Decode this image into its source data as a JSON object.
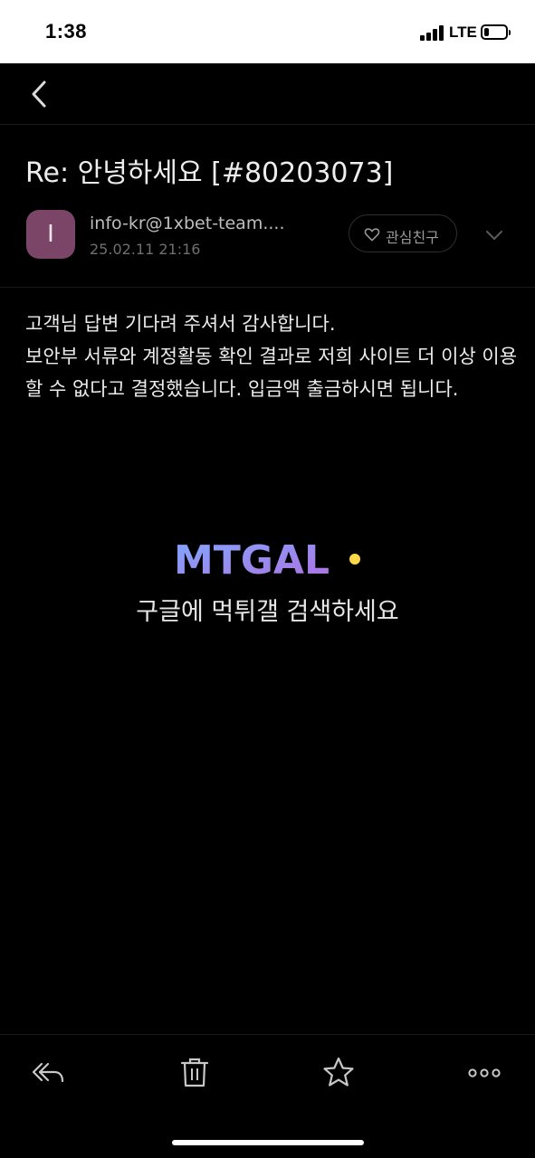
{
  "status_bar": {
    "time": "1:38",
    "network": "LTE",
    "battery_level": 0.2
  },
  "nav": {
    "back_icon": "chevron-left-icon"
  },
  "email": {
    "subject": "Re: 안녕하세요 [#80203073]",
    "sender": {
      "avatar_letter": "I",
      "avatar_color": "#7b4567",
      "email": "info-kr@1xbet-team....",
      "date": "25.02.11 21:16"
    },
    "favorite_label": "관심친구",
    "body_lines": [
      "고객님 답변 기다려 주셔서 감사합니다.",
      "보안부 서류와 계정활동 확인 결과로 저희 사이트 더 이상 이용할 수 없다고 결정했습니다. 입금액 출금하시면 됩니다."
    ]
  },
  "watermark": {
    "logo_text": "MTGAL",
    "caption": "구글에 먹튀갤 검색하세요"
  },
  "toolbar": {
    "icons": [
      "reply-icon",
      "trash-icon",
      "star-icon",
      "more-icon"
    ]
  },
  "colors": {
    "background": "#000000",
    "text": "#ececec",
    "accent_avatar": "#7b4567"
  }
}
